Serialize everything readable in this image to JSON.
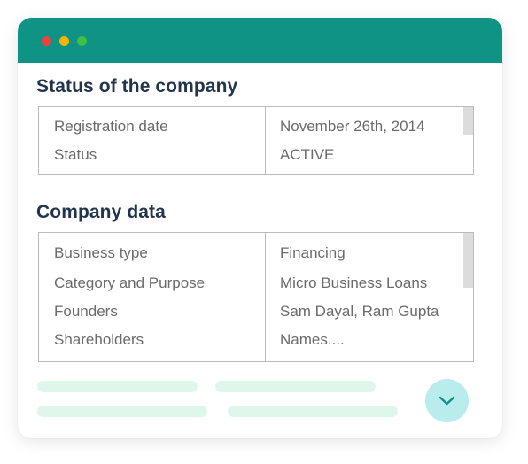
{
  "window": {
    "controls": [
      "close",
      "minimize",
      "maximize"
    ],
    "colors": {
      "titlebar": "#0e9384",
      "close": "#f0413c",
      "minimize": "#f5b400",
      "maximize": "#3fbf47",
      "heading": "#23354c",
      "skeleton": "#dff7ea",
      "expand_button": "#b9ecec"
    }
  },
  "status_section": {
    "title": "Status of the company",
    "rows": [
      {
        "label": "Registration date",
        "value": "November 26th, 2014"
      },
      {
        "label": "Status",
        "value": "ACTIVE"
      }
    ]
  },
  "company_section": {
    "title": "Company data",
    "rows": [
      {
        "label": "Business type",
        "value": "Financing"
      },
      {
        "label": "Category and Purpose",
        "value": "Micro Business Loans"
      },
      {
        "label": "Founders",
        "value": "Sam Dayal, Ram Gupta"
      },
      {
        "label": "Shareholders",
        "value": "Names...."
      }
    ]
  },
  "expand_button": {
    "icon": "chevron-down-icon"
  }
}
